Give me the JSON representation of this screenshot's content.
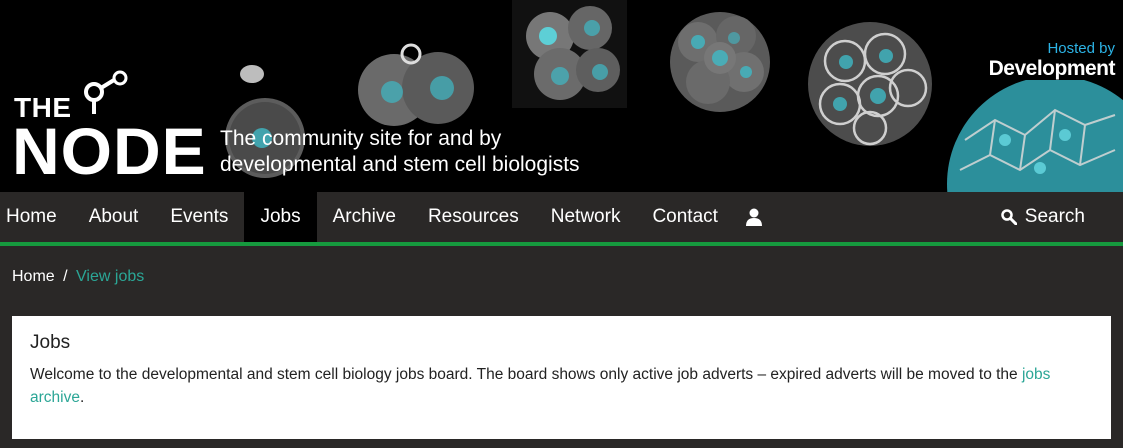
{
  "site": {
    "logo_the": "THE",
    "logo_node": "NODE",
    "tagline_line1": "The community site for and by",
    "tagline_line2": "developmental and stem cell biologists",
    "hosted_by": "Hosted by",
    "host_name": "Development"
  },
  "nav": {
    "items": [
      {
        "label": "Home"
      },
      {
        "label": "About"
      },
      {
        "label": "Events"
      },
      {
        "label": "Jobs",
        "active": true
      },
      {
        "label": "Archive"
      },
      {
        "label": "Resources"
      },
      {
        "label": "Network"
      },
      {
        "label": "Contact"
      }
    ],
    "user_icon": "user-icon",
    "search_icon": "search-icon",
    "search_label": "Search"
  },
  "breadcrumb": {
    "home": "Home",
    "separator": "/",
    "current": "View jobs"
  },
  "jobs": {
    "title": "Jobs",
    "intro": "Welcome to the developmental and stem cell biology jobs board. The board shows only active job adverts – expired adverts will be moved to the",
    "archive_link": "jobs archive",
    "period": "."
  },
  "colors": {
    "nav_border": "#169a3e",
    "link": "#2ba696",
    "hosted_by": "#2cb3e5"
  }
}
